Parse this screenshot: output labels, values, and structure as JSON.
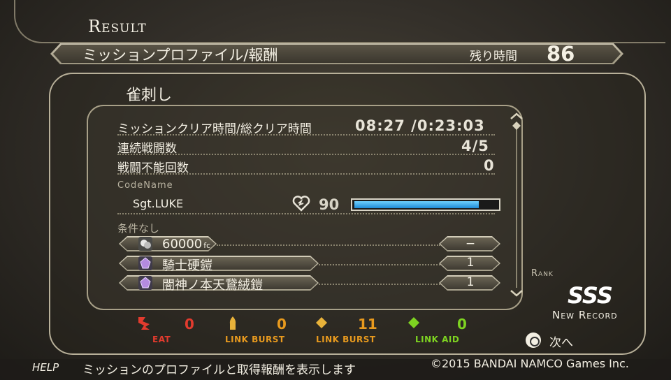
{
  "title": "Result",
  "header": {
    "label": "ミッションプロファイル/報酬",
    "time_label": "残り時間",
    "time_value": "86"
  },
  "mission_name": "雀刺し",
  "stats": [
    {
      "label": "ミッションクリア時間/総クリア時間",
      "value": "08:27 /0:23:03"
    },
    {
      "label": "連続戦闘数",
      "value": "4/5"
    },
    {
      "label": "戦闘不能回数",
      "value": "0"
    }
  ],
  "codename": {
    "label": "CodeName",
    "name": "Sgt.LUKE",
    "hp_value": "90",
    "hp_fraction": 0.87
  },
  "condition_label": "条件なし",
  "rewards": [
    {
      "name": "60000",
      "unit": "fc",
      "count": "−",
      "icon": "fc-money-icon",
      "color": "#d8d8d8"
    },
    {
      "name": "騎士硬鎧",
      "unit": "",
      "count": "1",
      "icon": "armor-gem-icon",
      "color": "#b48be0"
    },
    {
      "name": "闇神ノ本天鵞絨鎧",
      "unit": "",
      "count": "1",
      "icon": "armor-gem-icon",
      "color": "#b48be0"
    }
  ],
  "rank": {
    "label": "Rank",
    "value": "SSS",
    "note": "New Record"
  },
  "battle_stats": [
    {
      "icon": "eat-icon",
      "value": "0",
      "label": "EAT",
      "color": "#e23b2e"
    },
    {
      "icon": "bullet-icon",
      "value": "0",
      "label": "LINK BURST",
      "color": "#e89a1e"
    },
    {
      "icon": "diamond-icon",
      "value": "11",
      "label": "LINK BURST",
      "color": "#e89a1e"
    },
    {
      "icon": "green-diamond-icon",
      "value": "0",
      "label": "LINK AID",
      "color": "#7ed321"
    }
  ],
  "next": {
    "label": "次へ",
    "icon": "circle-button-icon"
  },
  "help": {
    "label": "HELP",
    "text": "ミッションのプロファイルと取得報酬を表示します"
  },
  "copyright": "©2015 BANDAI NAMCO Games Inc."
}
